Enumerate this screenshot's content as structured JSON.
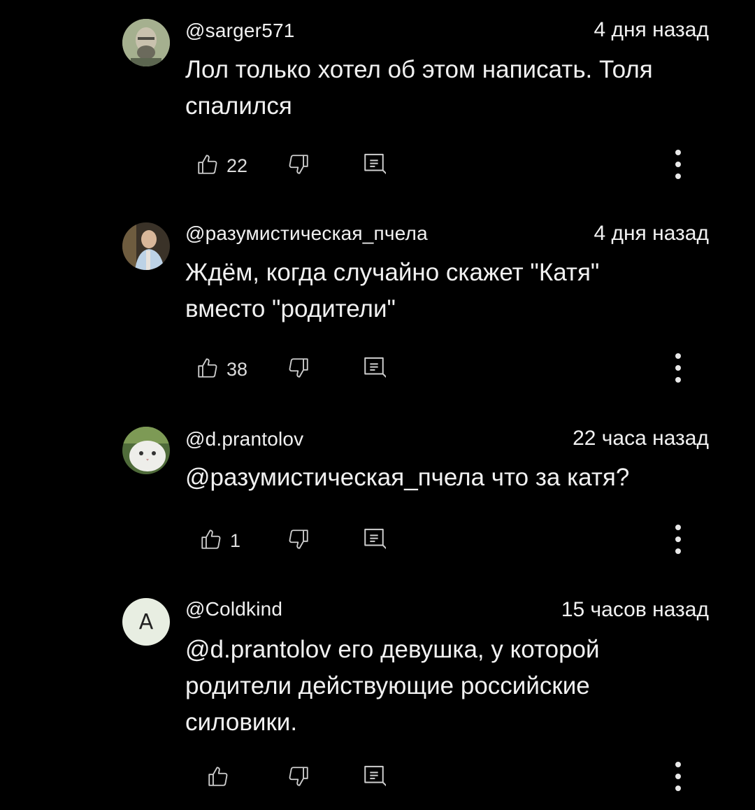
{
  "colors": {
    "background": "#000000",
    "text": "#f1f1f1",
    "icon": "#cfcfcf"
  },
  "comments": [
    {
      "author": "@sarger571",
      "time": "4 дня назад",
      "text": "Лол только хотел об этом написать. Толя\nспалился",
      "likes": "22",
      "avatar_icon": "bearded-man-avatar-icon"
    },
    {
      "author": "@разумистическая_пчела",
      "time": "4 дня назад",
      "text": "Ждём, когда случайно скажет \"Катя\"\nвместо \"родители\"",
      "likes": "38",
      "avatar_icon": "person-photo-avatar-icon"
    },
    {
      "author": "@d.prantolov",
      "time": "22 часа назад",
      "text": "@разумистическая_пчела что за катя?",
      "likes": "1",
      "avatar_icon": "white-cat-avatar-icon"
    },
    {
      "author": "@Coldkind",
      "time": "15 часов назад",
      "text": "@d.prantolov его девушка, у которой\nродители действующие российские\nсиловики.",
      "likes": "",
      "avatar_letter": "A"
    }
  ]
}
